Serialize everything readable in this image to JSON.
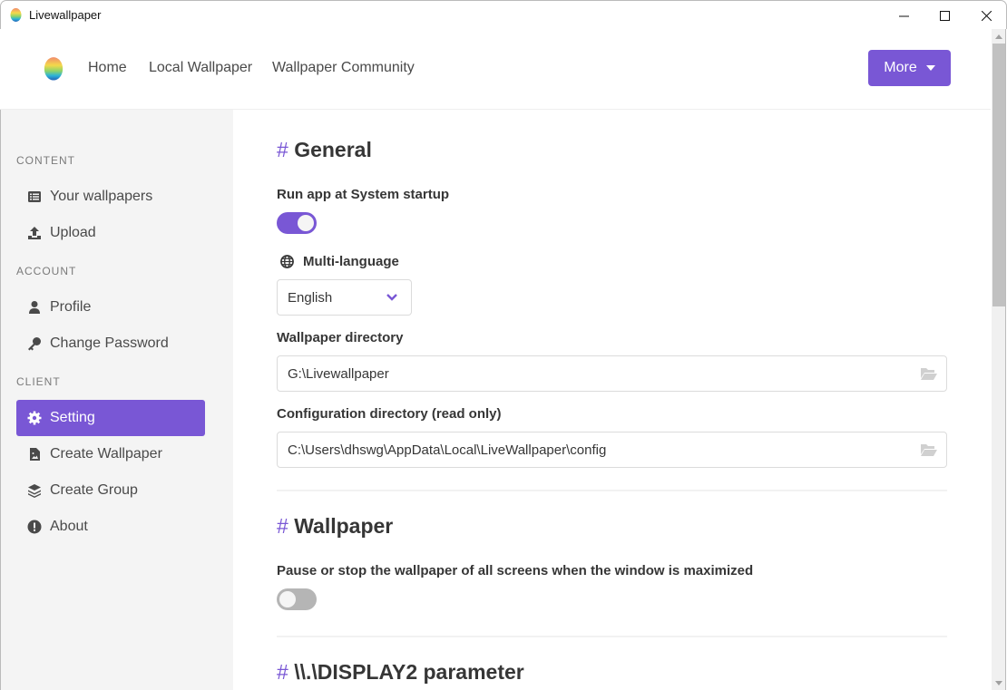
{
  "window": {
    "title": "Livewallpaper",
    "minimize_icon": "minimize-icon",
    "maximize_icon": "maximize-icon",
    "close_icon": "close-icon"
  },
  "header": {
    "nav": [
      "Home",
      "Local Wallpaper",
      "Wallpaper Community"
    ],
    "more_label": "More"
  },
  "sidebar": {
    "sections": [
      {
        "title": "CONTENT",
        "items": [
          {
            "label": "Your wallpapers",
            "icon": "list-icon"
          },
          {
            "label": "Upload",
            "icon": "upload-icon"
          }
        ]
      },
      {
        "title": "ACCOUNT",
        "items": [
          {
            "label": "Profile",
            "icon": "user-icon"
          },
          {
            "label": "Change Password",
            "icon": "key-icon"
          }
        ]
      },
      {
        "title": "CLIENT",
        "items": [
          {
            "label": "Setting",
            "icon": "gear-icon",
            "active": true
          },
          {
            "label": "Create Wallpaper",
            "icon": "file-image-icon"
          },
          {
            "label": "Create Group",
            "icon": "layers-icon"
          },
          {
            "label": "About",
            "icon": "exclamation-circle-icon"
          }
        ]
      }
    ]
  },
  "main": {
    "general": {
      "hash": "#",
      "title": "General",
      "startup_label": "Run app at System startup",
      "startup_on": true,
      "language_label": "Multi-language",
      "language_value": "English",
      "wallpaper_dir_label": "Wallpaper directory",
      "wallpaper_dir_value": "G:\\Livewallpaper",
      "config_dir_label": "Configuration directory (read only)",
      "config_dir_value": "C:\\Users\\dhswg\\AppData\\Local\\LiveWallpaper\\config"
    },
    "wallpaper": {
      "hash": "#",
      "title": "Wallpaper",
      "pause_label": "Pause or stop the wallpaper of all screens when the window is maximized",
      "pause_on": false
    },
    "display2": {
      "hash": "#",
      "title": "\\\\.\\DISPLAY2 parameter"
    }
  },
  "colors": {
    "accent": "#7957d5",
    "sidebar_bg": "#f4f4f4",
    "toggle_off": "#b5b5b5"
  }
}
